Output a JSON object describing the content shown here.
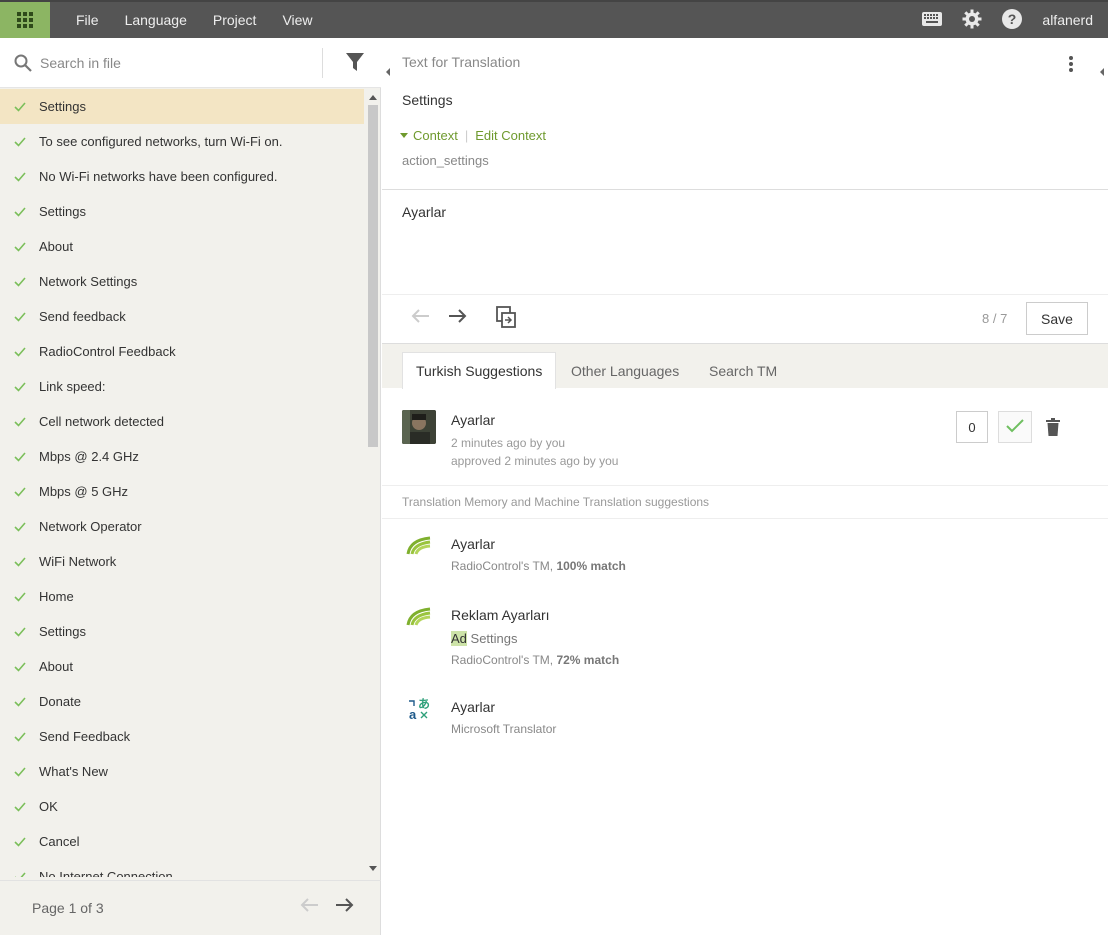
{
  "topbar": {
    "menu": [
      "File",
      "Language",
      "Project",
      "View"
    ],
    "username": "alfanerd"
  },
  "left": {
    "search_placeholder": "Search in file",
    "strings": [
      "Settings",
      "To see configured networks, turn Wi-Fi on.",
      "No Wi-Fi networks have been configured.",
      "Settings",
      "About",
      "Network Settings",
      "Send feedback",
      "RadioControl Feedback",
      "Link speed:",
      "Cell network detected",
      "Mbps @ 2.4 GHz",
      "Mbps @ 5 GHz",
      "Network Operator",
      "WiFi Network",
      "Home",
      "Settings",
      "About",
      "Donate",
      "Send Feedback",
      "What's New",
      "OK",
      "Cancel",
      "No Internet Connection"
    ],
    "pager": "Page 1 of 3"
  },
  "editor": {
    "source_header": "Text for Translation",
    "source_text": "Settings",
    "context_label": "Context",
    "edit_context_label": "Edit Context",
    "context_value": "action_settings",
    "translation": "Ayarlar",
    "count": "8 / 7",
    "save_label": "Save"
  },
  "tabs": [
    "Turkish Suggestions",
    "Other Languages",
    "Search TM"
  ],
  "suggestion": {
    "text": "Ayarlar",
    "meta1": "2 minutes ago by you",
    "meta2": "approved 2 minutes ago by you",
    "votes": "0"
  },
  "tm": {
    "title": "Translation Memory and Machine Translation suggestions",
    "items": [
      {
        "text": "Ayarlar",
        "source": "RadioControl's TM, ",
        "match": "100% match"
      },
      {
        "text": "Reklam Ayarları",
        "diff_added": "Ad",
        "diff_rest": " Settings",
        "source": "RadioControl's TM, ",
        "match": "72% match"
      },
      {
        "text": "Ayarlar",
        "source": "Microsoft Translator"
      }
    ]
  },
  "colors": {
    "accent_green": "#6f9a2e",
    "apps_button": "#8cb563",
    "topbar": "#555555",
    "active_row": "#f3e5c4"
  }
}
